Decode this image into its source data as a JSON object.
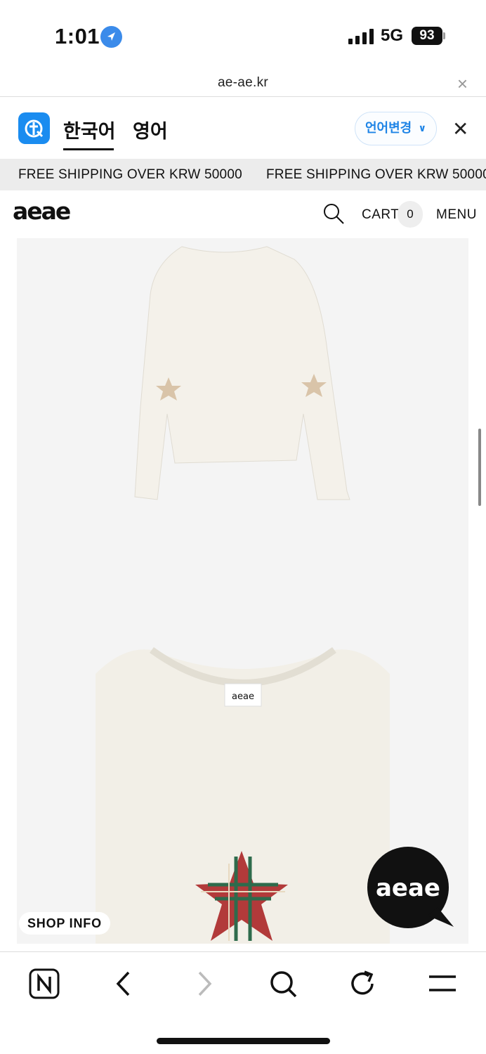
{
  "status": {
    "time": "1:01",
    "network": "5G",
    "battery": "93"
  },
  "url": {
    "domain": "ae-ae.kr"
  },
  "translate": {
    "lang_korean": "한국어",
    "lang_english": "영어",
    "change_button": "언어변경",
    "chevron": "∨"
  },
  "marquee": {
    "text_1": "FREE SHIPPING OVER KRW 50000",
    "text_2": "FREE SHIPPING OVER KRW 50000"
  },
  "header": {
    "logo": "aeae",
    "cart_label": "CART",
    "cart_count": "0",
    "menu_label": "MENU"
  },
  "product": {
    "label_tag": "aeae"
  },
  "floating": {
    "shop_info": "SHOP INFO",
    "chat_logo": "aeae"
  },
  "icons": {
    "location": "location-arrow-icon",
    "search": "search-icon",
    "close": "close-icon",
    "back": "back-icon",
    "forward": "forward-icon",
    "refresh": "refresh-icon",
    "menu": "hamburger-icon"
  },
  "colors": {
    "accent": "#1a8cf0",
    "marquee_bg": "#ececec",
    "product_bg": "#f4f4f4"
  }
}
